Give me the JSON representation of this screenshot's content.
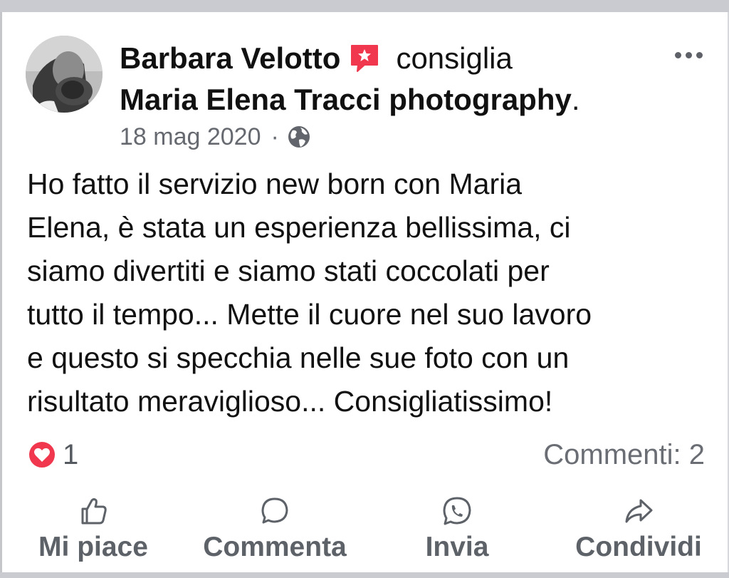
{
  "post": {
    "author": "Barbara Velotto",
    "action_verb": "consiglia",
    "page_name": "Maria Elena Tracci photography",
    "page_suffix": ".",
    "date": "18 mag 2020",
    "separator": "·",
    "audience_icon": "globe-icon",
    "badge_icon": "recommend-star-icon",
    "text_lines": [
      "Ho fatto il servizio new born con Maria",
      "Elena, è stata un esperienza bellissima, ci",
      "siamo divertiti e siamo stati coccolati per",
      "tutto il tempo... Mette il cuore nel suo lavoro",
      "e questo si specchia nelle sue foto con un",
      "risultato meraviglioso... Consigliatissimo!"
    ]
  },
  "reactions": {
    "type": "love",
    "count": "1",
    "comments_label": "Commenti: 2"
  },
  "actions": {
    "like": "Mi piace",
    "comment": "Commenta",
    "send": "Invia",
    "share": "Condividi"
  },
  "colors": {
    "accent_red": "#f0374d",
    "text_primary": "#111111",
    "text_secondary": "#666a70",
    "frame_gray": "#c9cbd0"
  }
}
